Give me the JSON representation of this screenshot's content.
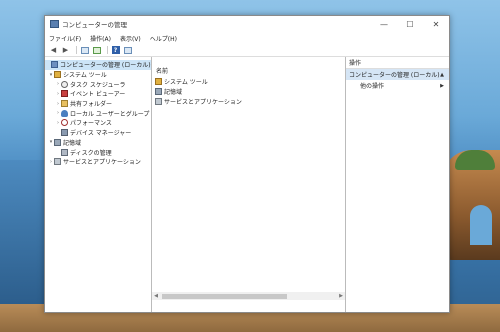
{
  "window": {
    "title": "コンピューターの管理"
  },
  "window_controls": {
    "minimize": "—",
    "maximize": "☐",
    "close": "✕"
  },
  "menu": [
    "ファイル(F)",
    "操作(A)",
    "表示(V)",
    "ヘルプ(H)"
  ],
  "toolbar": {
    "back": "◀",
    "forward": "▶",
    "help": "?"
  },
  "tree": {
    "root": "コンピューターの管理 (ローカル)",
    "system_tools": "システム ツール",
    "task_scheduler": "タスク スケジューラ",
    "event_viewer": "イベント ビューアー",
    "shared_folders": "共有フォルダー",
    "local_users": "ローカル ユーザーとグループ",
    "performance": "パフォーマンス",
    "device_manager": "デバイス マネージャー",
    "storage": "記憶域",
    "disk_management": "ディスクの管理",
    "services_apps": "サービスとアプリケーション"
  },
  "center": {
    "column_header": "名前",
    "items": [
      "システム ツール",
      "記憶域",
      "サービスとアプリケーション"
    ]
  },
  "actions": {
    "header": "操作",
    "selected": "コンピューターの管理 (ローカル)",
    "more": "他の操作"
  },
  "colors": {
    "selection": "#cce4f7",
    "action_selected": "#d5e5f5"
  }
}
